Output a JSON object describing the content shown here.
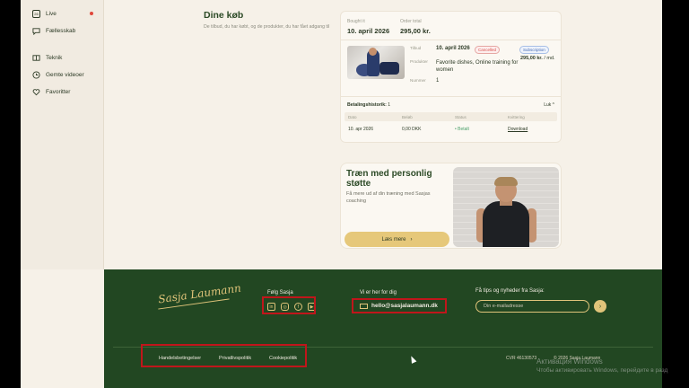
{
  "sidebar": {
    "items": [
      {
        "label": "Live",
        "icon": "live-icon"
      },
      {
        "label": "Fællesskab",
        "icon": "chat-icon"
      },
      {
        "label": "Teknik",
        "icon": "book-icon"
      },
      {
        "label": "Gemte videoer",
        "icon": "clock-icon"
      },
      {
        "label": "Favoritter",
        "icon": "heart-icon"
      }
    ]
  },
  "purchases": {
    "title": "Dine køb",
    "subtitle": "De tilbud, du har købt, og de produkter, du har fået adgang til"
  },
  "order": {
    "bought_label": "Bought it",
    "bought_value": "10. april 2026",
    "total_label": "Order total",
    "total_value": "295,00 kr.",
    "offer_label": "Tilbud",
    "offer_value": "10. april 2026",
    "status_badge": "Cancelled",
    "type_badge": "Subscription",
    "price_amount": "295,00 kr.",
    "price_period": "/ md.",
    "products_label": "Produkter",
    "products_value": "Favorite dishes, Online training for women",
    "number_label": "Nummer",
    "number_value": "1",
    "payment_history_label": "Betalingshistorik:",
    "payment_history_count": "1",
    "close_label": "Luk ^",
    "table": {
      "headers": [
        "Dato",
        "Beløb",
        "Status",
        "Kvittering"
      ],
      "rows": [
        {
          "date": "10. apr 2026",
          "amount": "0,00 DKK",
          "status": "• Betalt",
          "receipt": "Download"
        }
      ]
    }
  },
  "promo": {
    "title": "Træn med personlig støtte",
    "subtitle": "Få mere ud af din træning med Sasjas coaching",
    "button_label": "Læs mere",
    "button_arrow": "›"
  },
  "footer": {
    "logo_text": "Sasja Laumann",
    "follow_title": "Følg Sasja",
    "social_icons": [
      "linkedin-icon",
      "instagram-icon",
      "facebook-icon",
      "youtube-icon"
    ],
    "contact_title": "Vi er her for dig",
    "email": "hello@sasjalaumann.dk",
    "newsletter_title": "Få tips og nyheder fra Sasja:",
    "newsletter_placeholder": "Din e-mailadresse",
    "send_arrow": "›",
    "links": [
      "Handelsbetingelser",
      "Privatlivspolitik",
      "Cookiepolitik"
    ],
    "cvr": "CVR 46130573",
    "copyright": "© 2026 Sasja Laumann"
  },
  "windows_watermark": {
    "line1": "Активация Windows",
    "line2": "Чтобы активировать Windows, перейдите в разд"
  },
  "colors": {
    "brand_green": "#224722",
    "accent_gold": "#e0c47a",
    "highlight_red": "#c0161b"
  }
}
